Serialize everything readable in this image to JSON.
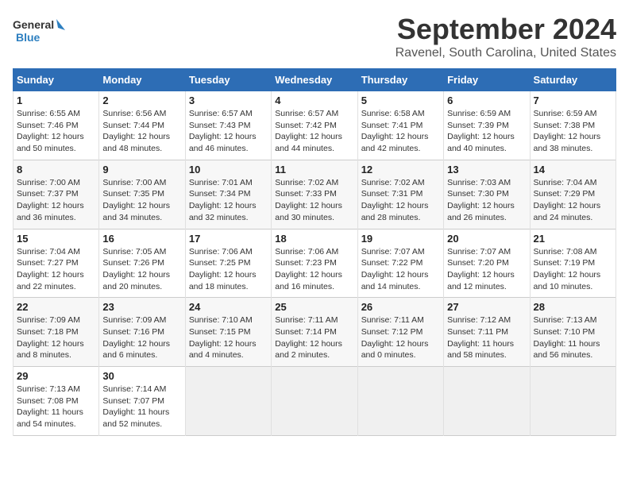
{
  "header": {
    "logo_line1": "General",
    "logo_line2": "Blue",
    "month": "September 2024",
    "location": "Ravenel, South Carolina, United States"
  },
  "days_of_week": [
    "Sunday",
    "Monday",
    "Tuesday",
    "Wednesday",
    "Thursday",
    "Friday",
    "Saturday"
  ],
  "weeks": [
    [
      {
        "num": "1",
        "sunrise": "6:55 AM",
        "sunset": "7:46 PM",
        "daylight": "12 hours and 50 minutes."
      },
      {
        "num": "2",
        "sunrise": "6:56 AM",
        "sunset": "7:44 PM",
        "daylight": "12 hours and 48 minutes."
      },
      {
        "num": "3",
        "sunrise": "6:57 AM",
        "sunset": "7:43 PM",
        "daylight": "12 hours and 46 minutes."
      },
      {
        "num": "4",
        "sunrise": "6:57 AM",
        "sunset": "7:42 PM",
        "daylight": "12 hours and 44 minutes."
      },
      {
        "num": "5",
        "sunrise": "6:58 AM",
        "sunset": "7:41 PM",
        "daylight": "12 hours and 42 minutes."
      },
      {
        "num": "6",
        "sunrise": "6:59 AM",
        "sunset": "7:39 PM",
        "daylight": "12 hours and 40 minutes."
      },
      {
        "num": "7",
        "sunrise": "6:59 AM",
        "sunset": "7:38 PM",
        "daylight": "12 hours and 38 minutes."
      }
    ],
    [
      {
        "num": "8",
        "sunrise": "7:00 AM",
        "sunset": "7:37 PM",
        "daylight": "12 hours and 36 minutes."
      },
      {
        "num": "9",
        "sunrise": "7:00 AM",
        "sunset": "7:35 PM",
        "daylight": "12 hours and 34 minutes."
      },
      {
        "num": "10",
        "sunrise": "7:01 AM",
        "sunset": "7:34 PM",
        "daylight": "12 hours and 32 minutes."
      },
      {
        "num": "11",
        "sunrise": "7:02 AM",
        "sunset": "7:33 PM",
        "daylight": "12 hours and 30 minutes."
      },
      {
        "num": "12",
        "sunrise": "7:02 AM",
        "sunset": "7:31 PM",
        "daylight": "12 hours and 28 minutes."
      },
      {
        "num": "13",
        "sunrise": "7:03 AM",
        "sunset": "7:30 PM",
        "daylight": "12 hours and 26 minutes."
      },
      {
        "num": "14",
        "sunrise": "7:04 AM",
        "sunset": "7:29 PM",
        "daylight": "12 hours and 24 minutes."
      }
    ],
    [
      {
        "num": "15",
        "sunrise": "7:04 AM",
        "sunset": "7:27 PM",
        "daylight": "12 hours and 22 minutes."
      },
      {
        "num": "16",
        "sunrise": "7:05 AM",
        "sunset": "7:26 PM",
        "daylight": "12 hours and 20 minutes."
      },
      {
        "num": "17",
        "sunrise": "7:06 AM",
        "sunset": "7:25 PM",
        "daylight": "12 hours and 18 minutes."
      },
      {
        "num": "18",
        "sunrise": "7:06 AM",
        "sunset": "7:23 PM",
        "daylight": "12 hours and 16 minutes."
      },
      {
        "num": "19",
        "sunrise": "7:07 AM",
        "sunset": "7:22 PM",
        "daylight": "12 hours and 14 minutes."
      },
      {
        "num": "20",
        "sunrise": "7:07 AM",
        "sunset": "7:20 PM",
        "daylight": "12 hours and 12 minutes."
      },
      {
        "num": "21",
        "sunrise": "7:08 AM",
        "sunset": "7:19 PM",
        "daylight": "12 hours and 10 minutes."
      }
    ],
    [
      {
        "num": "22",
        "sunrise": "7:09 AM",
        "sunset": "7:18 PM",
        "daylight": "12 hours and 8 minutes."
      },
      {
        "num": "23",
        "sunrise": "7:09 AM",
        "sunset": "7:16 PM",
        "daylight": "12 hours and 6 minutes."
      },
      {
        "num": "24",
        "sunrise": "7:10 AM",
        "sunset": "7:15 PM",
        "daylight": "12 hours and 4 minutes."
      },
      {
        "num": "25",
        "sunrise": "7:11 AM",
        "sunset": "7:14 PM",
        "daylight": "12 hours and 2 minutes."
      },
      {
        "num": "26",
        "sunrise": "7:11 AM",
        "sunset": "7:12 PM",
        "daylight": "12 hours and 0 minutes."
      },
      {
        "num": "27",
        "sunrise": "7:12 AM",
        "sunset": "7:11 PM",
        "daylight": "11 hours and 58 minutes."
      },
      {
        "num": "28",
        "sunrise": "7:13 AM",
        "sunset": "7:10 PM",
        "daylight": "11 hours and 56 minutes."
      }
    ],
    [
      {
        "num": "29",
        "sunrise": "7:13 AM",
        "sunset": "7:08 PM",
        "daylight": "11 hours and 54 minutes."
      },
      {
        "num": "30",
        "sunrise": "7:14 AM",
        "sunset": "7:07 PM",
        "daylight": "11 hours and 52 minutes."
      },
      null,
      null,
      null,
      null,
      null
    ]
  ]
}
